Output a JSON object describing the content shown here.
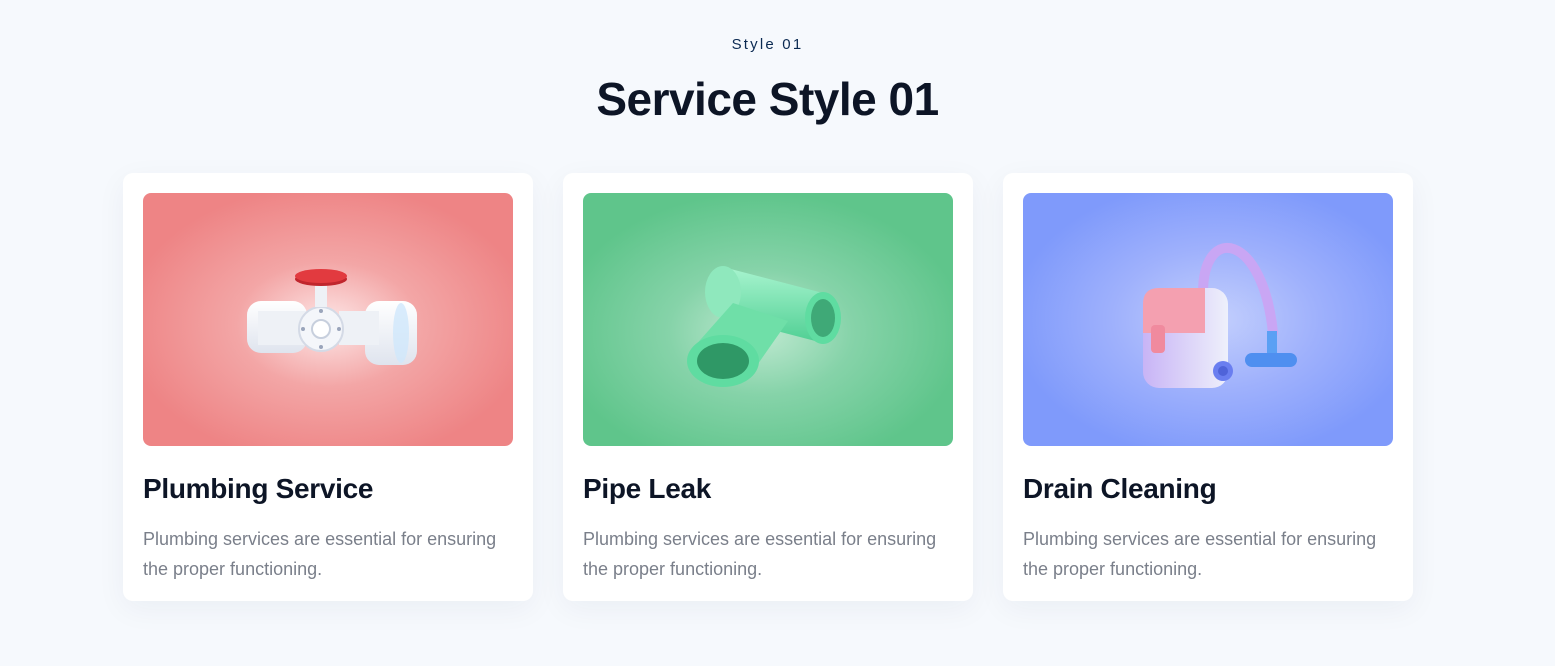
{
  "section": {
    "eyebrow": "Style 01",
    "heading": "Service Style 01"
  },
  "cards": [
    {
      "title": "Plumbing Service",
      "text": "Plumbing services are essential for ensuring the proper functioning.",
      "icon": "valve-icon",
      "background": "#ee8485"
    },
    {
      "title": "Pipe Leak",
      "text": "Plumbing services are essential for ensuring the proper functioning.",
      "icon": "tee-pipe-icon",
      "background": "#5fc58b"
    },
    {
      "title": "Drain Cleaning",
      "text": "Plumbing services are essential for ensuring the proper functioning.",
      "icon": "vacuum-cleaner-icon",
      "background": "#7f9afb"
    }
  ]
}
